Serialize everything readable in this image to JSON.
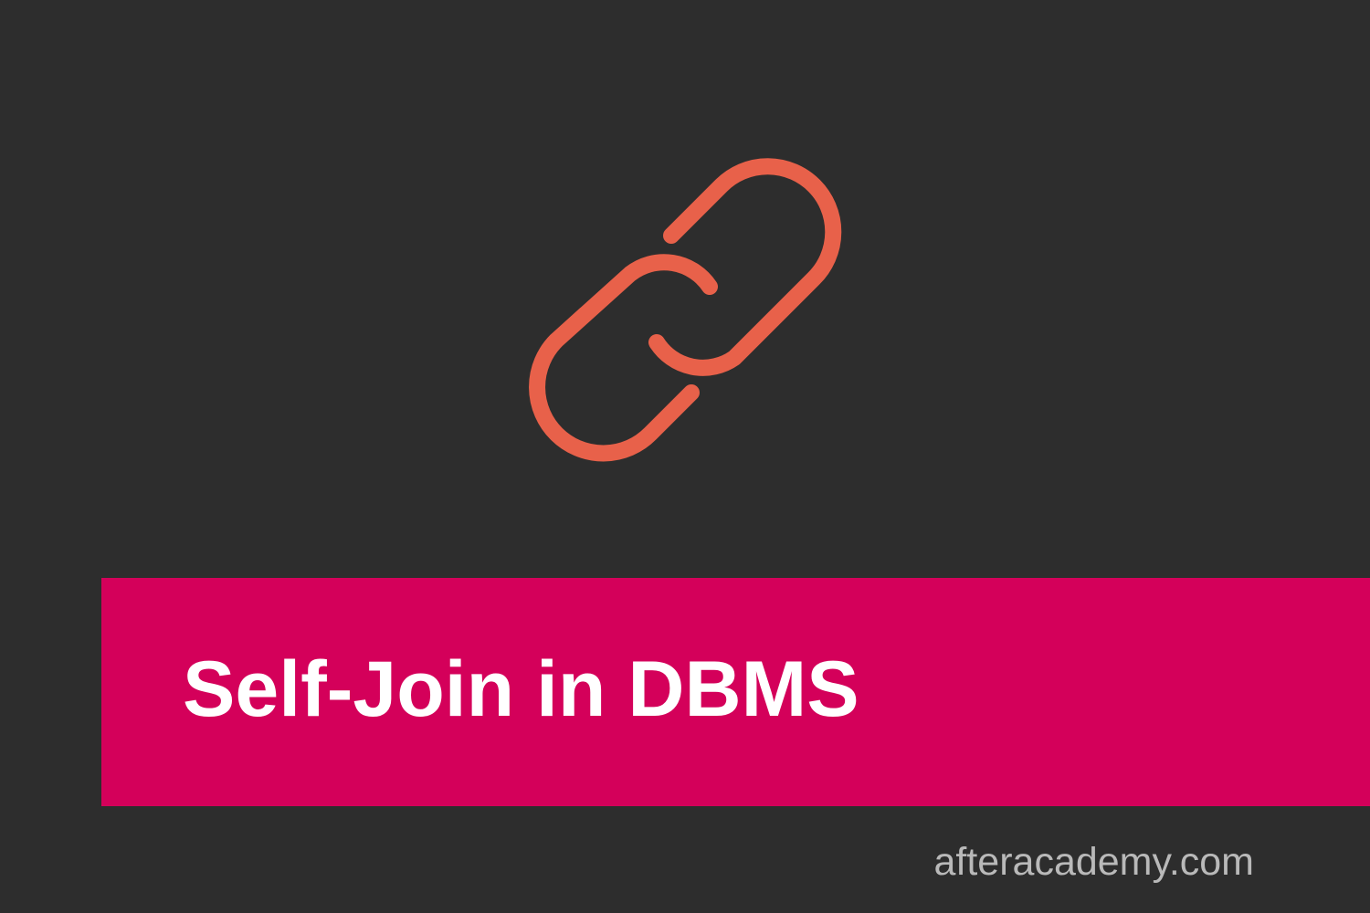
{
  "banner": {
    "title": "Self-Join in DBMS"
  },
  "footer": {
    "site": "afteracademy.com"
  },
  "icon": {
    "name": "chain-link-icon"
  },
  "colors": {
    "background": "#2d2d2d",
    "banner": "#d4005a",
    "icon": "#e8614a",
    "title_text": "#ffffff",
    "site_text": "#b9b9b9"
  }
}
